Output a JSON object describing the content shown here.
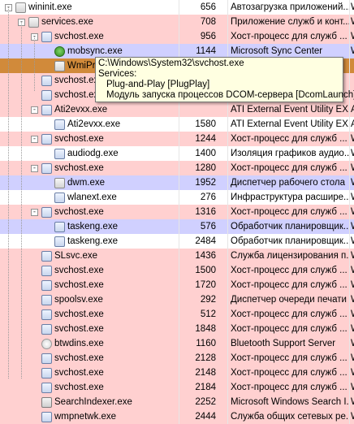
{
  "tooltip": {
    "path": "C:\\Windows\\System32\\svchost.exe",
    "services_heading": "Services:",
    "services": [
      "Plug-and-Play [PlugPlay]",
      "Модуль запуска процессов DCOM-сервера [DcomLaunch]"
    ]
  },
  "rows": [
    {
      "name": "wininit.exe",
      "pid": "656",
      "desc": "Автозагрузка приложений...",
      "level": 0,
      "toggle": "-",
      "icon": "win",
      "color": "none",
      "trail": "W"
    },
    {
      "name": "services.exe",
      "pid": "708",
      "desc": "Приложение служб и конт...",
      "level": 1,
      "toggle": "-",
      "icon": "win",
      "color": "pink",
      "trail": "W"
    },
    {
      "name": "svchost.exe",
      "pid": "956",
      "desc": "Хост-процесс для служб ...",
      "level": 2,
      "toggle": "-",
      "icon": "exe",
      "color": "pink",
      "trail": "W"
    },
    {
      "name": "mobsync.exe",
      "pid": "1144",
      "desc": "Microsoft Sync Center",
      "level": 3,
      "toggle": "",
      "icon": "sync",
      "color": "lav",
      "trail": "W"
    },
    {
      "name": "WmiPrvSE.exe",
      "pid": "",
      "desc": "",
      "level": 3,
      "toggle": "",
      "icon": "win",
      "color": "orange",
      "trail": ""
    },
    {
      "name": "svchost.exe",
      "pid": "",
      "desc": "",
      "level": 2,
      "toggle": "",
      "icon": "exe",
      "color": "pink",
      "trail": ""
    },
    {
      "name": "svchost.exe",
      "pid": "",
      "desc": "",
      "level": 2,
      "toggle": "",
      "icon": "exe",
      "color": "pink",
      "trail": ""
    },
    {
      "name": "Ati2evxx.exe",
      "pid": "",
      "desc": "ATI External Event Utility EX...",
      "level": 2,
      "toggle": "-",
      "icon": "exe",
      "color": "pink",
      "trail": "A"
    },
    {
      "name": "Ati2evxx.exe",
      "pid": "1580",
      "desc": "ATI External Event Utility EX...",
      "level": 3,
      "toggle": "",
      "icon": "exe",
      "color": "none",
      "trail": "A"
    },
    {
      "name": "svchost.exe",
      "pid": "1244",
      "desc": "Хост-процесс для служб ...",
      "level": 2,
      "toggle": "-",
      "icon": "exe",
      "color": "pink",
      "trail": "W"
    },
    {
      "name": "audiodg.exe",
      "pid": "1400",
      "desc": "Изоляция графиков аудио...",
      "level": 3,
      "toggle": "",
      "icon": "exe",
      "color": "none",
      "trail": "W"
    },
    {
      "name": "svchost.exe",
      "pid": "1280",
      "desc": "Хост-процесс для служб ...",
      "level": 2,
      "toggle": "-",
      "icon": "exe",
      "color": "pink",
      "trail": "W"
    },
    {
      "name": "dwm.exe",
      "pid": "1952",
      "desc": "Диспетчер рабочего стола",
      "level": 3,
      "toggle": "",
      "icon": "win",
      "color": "lav",
      "trail": "W"
    },
    {
      "name": "wlanext.exe",
      "pid": "276",
      "desc": "Инфраструктура расшире...",
      "level": 3,
      "toggle": "",
      "icon": "exe",
      "color": "none",
      "trail": "W"
    },
    {
      "name": "svchost.exe",
      "pid": "1316",
      "desc": "Хост-процесс для служб ...",
      "level": 2,
      "toggle": "-",
      "icon": "exe",
      "color": "pink",
      "trail": "W"
    },
    {
      "name": "taskeng.exe",
      "pid": "576",
      "desc": "Обработчик планировщик...",
      "level": 3,
      "toggle": "",
      "icon": "exe",
      "color": "lav",
      "trail": "W"
    },
    {
      "name": "taskeng.exe",
      "pid": "2484",
      "desc": "Обработчик планировщик...",
      "level": 3,
      "toggle": "",
      "icon": "exe",
      "color": "none",
      "trail": "W"
    },
    {
      "name": "SLsvc.exe",
      "pid": "1436",
      "desc": "Служба лицензирования п...",
      "level": 2,
      "toggle": "",
      "icon": "exe",
      "color": "pink",
      "trail": "W"
    },
    {
      "name": "svchost.exe",
      "pid": "1500",
      "desc": "Хост-процесс для служб ...",
      "level": 2,
      "toggle": "",
      "icon": "exe",
      "color": "pink",
      "trail": "W"
    },
    {
      "name": "svchost.exe",
      "pid": "1720",
      "desc": "Хост-процесс для служб ...",
      "level": 2,
      "toggle": "",
      "icon": "exe",
      "color": "pink",
      "trail": "W"
    },
    {
      "name": "spoolsv.exe",
      "pid": "292",
      "desc": "Диспетчер очереди печати",
      "level": 2,
      "toggle": "",
      "icon": "exe",
      "color": "pink",
      "trail": "W"
    },
    {
      "name": "svchost.exe",
      "pid": "512",
      "desc": "Хост-процесс для служб ...",
      "level": 2,
      "toggle": "",
      "icon": "exe",
      "color": "pink",
      "trail": "W"
    },
    {
      "name": "svchost.exe",
      "pid": "1848",
      "desc": "Хост-процесс для служб ...",
      "level": 2,
      "toggle": "",
      "icon": "exe",
      "color": "pink",
      "trail": "W"
    },
    {
      "name": "btwdins.exe",
      "pid": "1160",
      "desc": "Bluetooth Support Server",
      "level": 2,
      "toggle": "",
      "icon": "bt",
      "color": "pink",
      "trail": "W"
    },
    {
      "name": "svchost.exe",
      "pid": "2128",
      "desc": "Хост-процесс для служб ...",
      "level": 2,
      "toggle": "",
      "icon": "exe",
      "color": "pink",
      "trail": "W"
    },
    {
      "name": "svchost.exe",
      "pid": "2148",
      "desc": "Хост-процесс для служб ...",
      "level": 2,
      "toggle": "",
      "icon": "exe",
      "color": "pink",
      "trail": "W"
    },
    {
      "name": "svchost.exe",
      "pid": "2184",
      "desc": "Хост-процесс для служб ...",
      "level": 2,
      "toggle": "",
      "icon": "exe",
      "color": "pink",
      "trail": "W"
    },
    {
      "name": "SearchIndexer.exe",
      "pid": "2252",
      "desc": "Microsoft Windows Search I...",
      "level": 2,
      "toggle": "",
      "icon": "srch",
      "color": "pink",
      "trail": "W"
    },
    {
      "name": "wmpnetwk.exe",
      "pid": "2444",
      "desc": "Служба общих сетевых ре...",
      "level": 2,
      "toggle": "",
      "icon": "exe",
      "color": "pink",
      "trail": "W"
    }
  ]
}
